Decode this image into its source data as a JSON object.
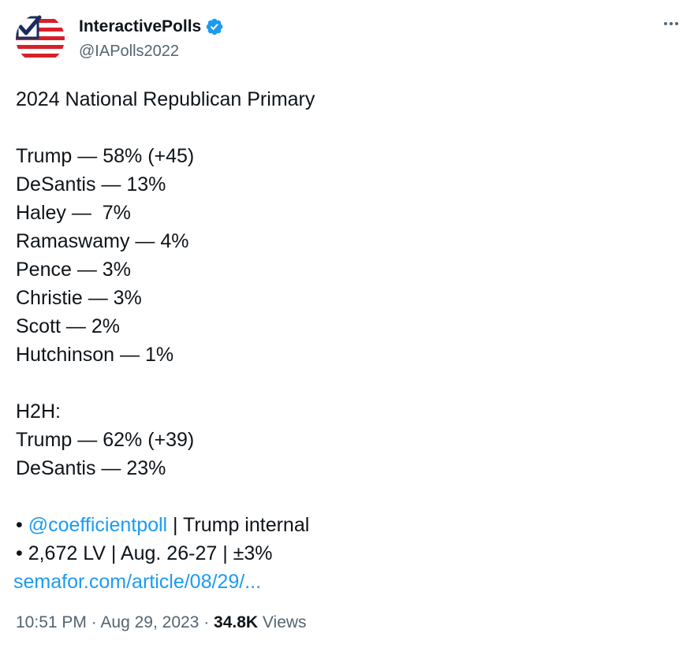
{
  "author": {
    "display_name": "InteractivePolls",
    "handle": "@IAPolls2022",
    "verified": true
  },
  "more_icon": "ellipsis-icon",
  "tweet": {
    "title": "2024 National Republican Primary",
    "primary": [
      {
        "name": "Trump",
        "sep": " — ",
        "value": "58% (+45)"
      },
      {
        "name": "DeSantis",
        "sep": " — ",
        "value": "13%"
      },
      {
        "name": "Haley",
        "sep": " —  ",
        "value": "7%"
      },
      {
        "name": "Ramaswamy",
        "sep": " — ",
        "value": "4%"
      },
      {
        "name": "Pence",
        "sep": " — ",
        "value": "3%"
      },
      {
        "name": "Christie",
        "sep": " — ",
        "value": "3%"
      },
      {
        "name": "Scott",
        "sep": " — ",
        "value": "2%"
      },
      {
        "name": "Hutchinson",
        "sep": " — ",
        "value": "1%"
      }
    ],
    "h2h_label": "H2H:",
    "h2h": [
      {
        "name": "Trump",
        "sep": " — ",
        "value": "62% (+39)"
      },
      {
        "name": "DeSantis",
        "sep": " — ",
        "value": "23%"
      }
    ],
    "source_bullet": "• ",
    "source_mention": "@coefficientpoll",
    "source_suffix": " | Trump internal",
    "details": "• 2,672 LV | Aug. 26-27 | ±3%",
    "link": "semafor.com/article/08/29/..."
  },
  "meta": {
    "time": "10:51 PM",
    "dot1": " · ",
    "date": "Aug 29, 2023",
    "dot2": " · ",
    "views_count": "34.8K",
    "views_label": " Views"
  },
  "colors": {
    "text": "#0f1419",
    "secondary": "#536471",
    "link": "#1d9bf0",
    "verified": "#1d9bf0"
  }
}
